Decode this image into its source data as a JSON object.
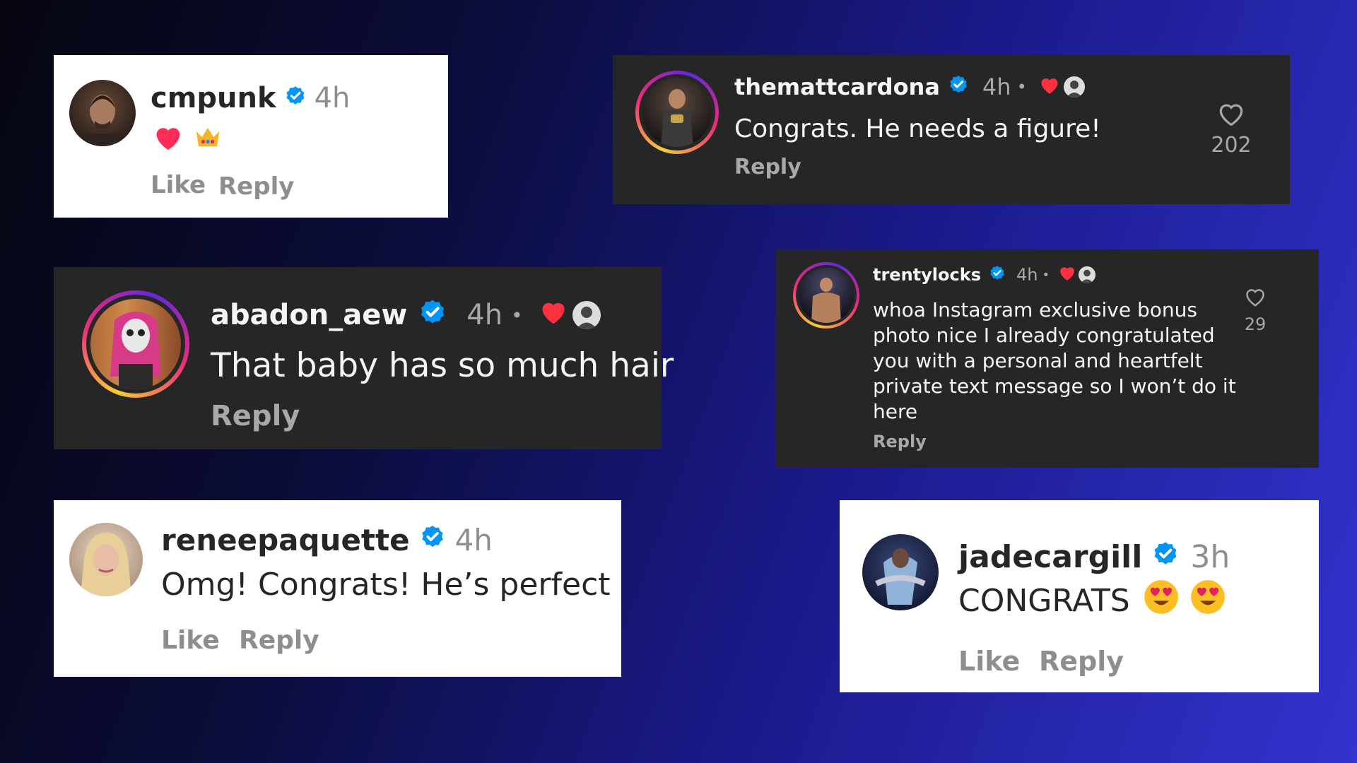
{
  "colors": {
    "verified_blue": "#0095f6",
    "heart_red": "#ff3040",
    "card_dark": "#262626",
    "card_light": "#ffffff"
  },
  "comments": [
    {
      "username": "cmpunk",
      "time": "4h",
      "reactions": [
        "heart-emoji",
        "crown-emoji"
      ],
      "like_label": "Like",
      "reply_label": "Reply"
    },
    {
      "username": "themattcardona",
      "time": "4h",
      "separator": "•",
      "text": "Congrats. He needs a figure!",
      "reply_label": "Reply",
      "likes": "202"
    },
    {
      "username": "abadon_aew",
      "time": "4h",
      "separator": "•",
      "text": "That baby has so much hair",
      "reply_label": "Reply"
    },
    {
      "username": "trentylocks",
      "time": "4h",
      "separator": "•",
      "text_lines": [
        "whoa Instagram exclusive bonus",
        "photo nice I already congratulated",
        "you with a personal and heartfelt",
        "private text message so I won’t do it",
        "here"
      ],
      "reply_label": "Reply",
      "likes": "29"
    },
    {
      "username": "reneepaquette",
      "time": "4h",
      "text": "Omg! Congrats! He’s perfect",
      "like_label": "Like",
      "reply_label": "Reply"
    },
    {
      "username": "jadecargill",
      "time": "3h",
      "text": "CONGRATS",
      "reactions": [
        "heart-eyes-emoji",
        "heart-eyes-emoji"
      ],
      "like_label": "Like",
      "reply_label": "Reply"
    }
  ]
}
